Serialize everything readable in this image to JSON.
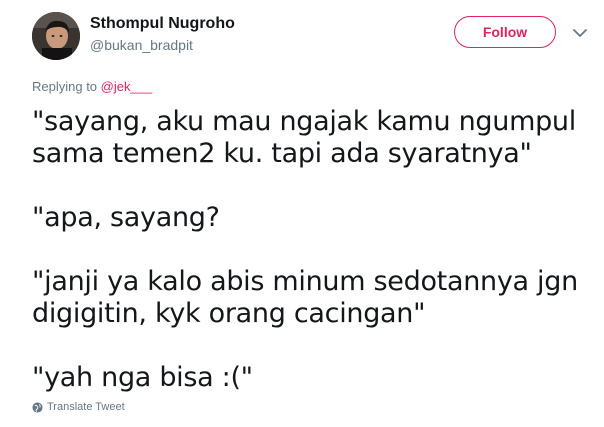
{
  "author": {
    "display_name": "Sthompul Nugroho",
    "handle": "@bukan_bradpit"
  },
  "follow_label": "Follow",
  "reply_context": {
    "prefix": "Replying to ",
    "mention": "@jek___"
  },
  "tweet_text": "\"sayang, aku mau ngajak kamu ngumpul sama temen2 ku. tapi ada syaratnya\"\n\n\"apa, sayang?\n\n\"janji ya kalo abis minum sedotannya jgn digigitin, kyk orang cacingan\"\n\n\"yah nga bisa :(\"",
  "translate_label": "Translate Tweet",
  "colors": {
    "accent": "#e0245e",
    "secondary_text": "#657786",
    "primary_text": "#14171a"
  },
  "icons": {
    "caret": "chevron-down-icon",
    "translate": "globe-icon"
  }
}
